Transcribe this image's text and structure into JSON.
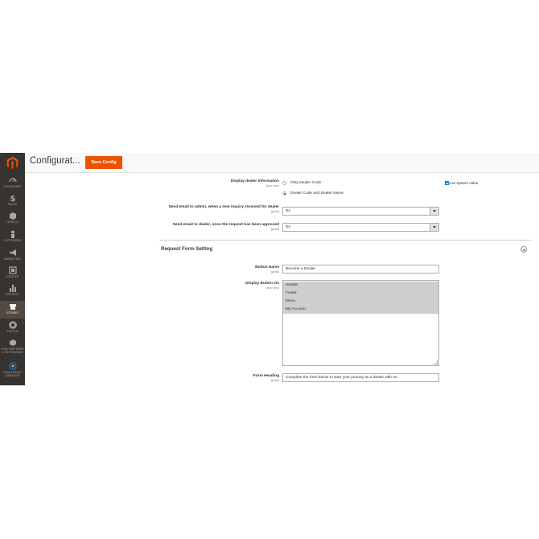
{
  "sidebar": {
    "items": [
      {
        "label": "DASHBOARD",
        "icon": "dashboard-icon"
      },
      {
        "label": "SALES",
        "icon": "dollar-icon"
      },
      {
        "label": "CATALOG",
        "icon": "box-icon"
      },
      {
        "label": "CUSTOMERS",
        "icon": "person-icon"
      },
      {
        "label": "MARKETING",
        "icon": "megaphone-icon"
      },
      {
        "label": "CONTENT",
        "icon": "content-icon"
      },
      {
        "label": "REPORTS",
        "icon": "bar-chart-icon"
      },
      {
        "label": "STORES",
        "icon": "store-icon"
      },
      {
        "label": "SYSTEM",
        "icon": "gear-icon"
      },
      {
        "label": "FIND PARTNERS & EXTENSIONS",
        "icon": "extensions-icon"
      },
      {
        "label": "DEALERSHIP MANAGER",
        "icon": "dealership-icon"
      }
    ]
  },
  "header": {
    "title": "Configurat...",
    "save_label": "Save Config"
  },
  "fields": {
    "display_dealer_info": {
      "label": "Display dealer information",
      "scope": "[store view]",
      "options": [
        "Only Dealer Code",
        "Dealer Code and Dealer Name"
      ],
      "selected": "Dealer Code and Dealer Name",
      "use_system_value": "Use system value"
    },
    "send_email_admin": {
      "label": "Send email to admin, when a new inquiry received for dealer",
      "scope": "[global]",
      "value": "No"
    },
    "send_email_dealer": {
      "label": "Send email to dealer, once the request has been approved",
      "scope": "[global]",
      "value": "No"
    }
  },
  "section": {
    "title": "Request Form Setting"
  },
  "request_form": {
    "button_name": {
      "label": "Button Name",
      "scope": "[global]",
      "value": "Become a Dealer"
    },
    "display_button_on": {
      "label": "Display Button On",
      "scope": "[store view]",
      "options": [
        "Header",
        "Footer",
        "Menu",
        "My Account"
      ]
    },
    "form_heading": {
      "label": "Form Heading",
      "scope": "[global]",
      "value": "Complete the form below to start your journey as a dealer with us"
    }
  },
  "colors": {
    "sidebar_bg": "#373330",
    "accent": "#eb5202",
    "active_nav": "#514943"
  }
}
